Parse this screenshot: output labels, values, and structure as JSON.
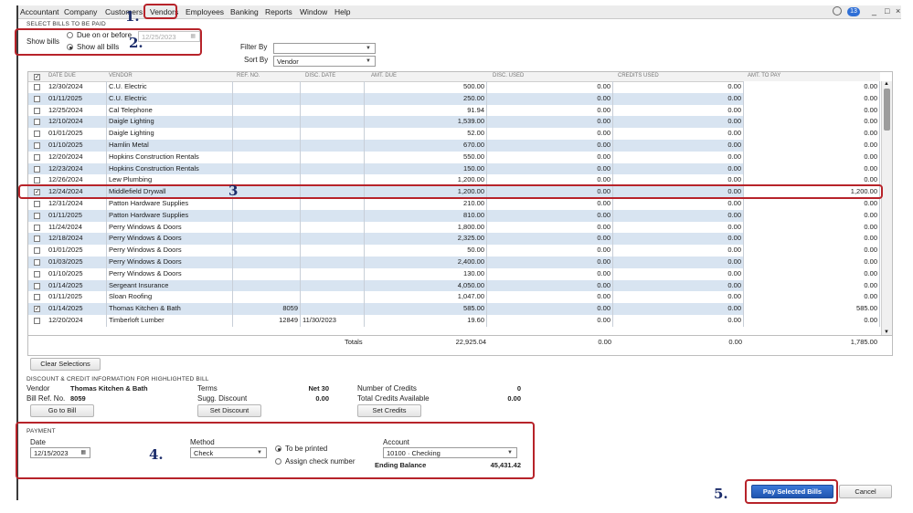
{
  "menu": {
    "items": [
      "Accountant",
      "Company",
      "Customers",
      "Vendors",
      "Employees",
      "Banking",
      "Reports",
      "Window",
      "Help"
    ],
    "notification_count": "13",
    "window_controls": [
      "_",
      "×"
    ]
  },
  "select_bills": {
    "section_title": "SELECT BILLS TO BE PAID",
    "show_bills_label": "Show bills",
    "due_on_or_before_label": "Due on or before",
    "due_date_value": "12/25/2023",
    "show_all_bills_label": "Show all bills",
    "filter_by_label": "Filter By",
    "filter_by_value": "",
    "sort_by_label": "Sort By",
    "sort_by_value": "Vendor"
  },
  "table": {
    "headers": [
      "DATE DUE",
      "VENDOR",
      "REF. NO.",
      "DISC. DATE",
      "AMT. DUE",
      "DISC. USED",
      "CREDITS USED",
      "AMT. TO PAY"
    ],
    "rows": [
      {
        "checked": false,
        "date": "12/30/2024",
        "vendor": "C.U. Electric",
        "ref": "",
        "disc_date": "",
        "amt_due": "500.00",
        "disc_used": "0.00",
        "credits_used": "0.00",
        "amt_to_pay": "0.00"
      },
      {
        "checked": false,
        "date": "01/11/2025",
        "vendor": "C.U. Electric",
        "ref": "",
        "disc_date": "",
        "amt_due": "250.00",
        "disc_used": "0.00",
        "credits_used": "0.00",
        "amt_to_pay": "0.00"
      },
      {
        "checked": false,
        "date": "12/25/2024",
        "vendor": "Cal Telephone",
        "ref": "",
        "disc_date": "",
        "amt_due": "91.94",
        "disc_used": "0.00",
        "credits_used": "0.00",
        "amt_to_pay": "0.00"
      },
      {
        "checked": false,
        "date": "12/10/2024",
        "vendor": "Daigle Lighting",
        "ref": "",
        "disc_date": "",
        "amt_due": "1,539.00",
        "disc_used": "0.00",
        "credits_used": "0.00",
        "amt_to_pay": "0.00"
      },
      {
        "checked": false,
        "date": "01/01/2025",
        "vendor": "Daigle Lighting",
        "ref": "",
        "disc_date": "",
        "amt_due": "52.00",
        "disc_used": "0.00",
        "credits_used": "0.00",
        "amt_to_pay": "0.00"
      },
      {
        "checked": false,
        "date": "01/10/2025",
        "vendor": "Hamlin Metal",
        "ref": "",
        "disc_date": "",
        "amt_due": "670.00",
        "disc_used": "0.00",
        "credits_used": "0.00",
        "amt_to_pay": "0.00"
      },
      {
        "checked": false,
        "date": "12/20/2024",
        "vendor": "Hopkins Construction Rentals",
        "ref": "",
        "disc_date": "",
        "amt_due": "550.00",
        "disc_used": "0.00",
        "credits_used": "0.00",
        "amt_to_pay": "0.00"
      },
      {
        "checked": false,
        "date": "12/23/2024",
        "vendor": "Hopkins Construction Rentals",
        "ref": "",
        "disc_date": "",
        "amt_due": "150.00",
        "disc_used": "0.00",
        "credits_used": "0.00",
        "amt_to_pay": "0.00"
      },
      {
        "checked": false,
        "date": "12/26/2024",
        "vendor": "Lew Plumbing",
        "ref": "",
        "disc_date": "",
        "amt_due": "1,200.00",
        "disc_used": "0.00",
        "credits_used": "0.00",
        "amt_to_pay": "0.00"
      },
      {
        "checked": true,
        "date": "12/24/2024",
        "vendor": "Middlefield Drywall",
        "ref": "",
        "disc_date": "",
        "amt_due": "1,200.00",
        "disc_used": "0.00",
        "credits_used": "0.00",
        "amt_to_pay": "1,200.00"
      },
      {
        "checked": false,
        "date": "12/31/2024",
        "vendor": "Patton Hardware Supplies",
        "ref": "",
        "disc_date": "",
        "amt_due": "210.00",
        "disc_used": "0.00",
        "credits_used": "0.00",
        "amt_to_pay": "0.00"
      },
      {
        "checked": false,
        "date": "01/11/2025",
        "vendor": "Patton Hardware Supplies",
        "ref": "",
        "disc_date": "",
        "amt_due": "810.00",
        "disc_used": "0.00",
        "credits_used": "0.00",
        "amt_to_pay": "0.00"
      },
      {
        "checked": false,
        "date": "11/24/2024",
        "vendor": "Perry Windows & Doors",
        "ref": "",
        "disc_date": "",
        "amt_due": "1,800.00",
        "disc_used": "0.00",
        "credits_used": "0.00",
        "amt_to_pay": "0.00"
      },
      {
        "checked": false,
        "date": "12/18/2024",
        "vendor": "Perry Windows & Doors",
        "ref": "",
        "disc_date": "",
        "amt_due": "2,325.00",
        "disc_used": "0.00",
        "credits_used": "0.00",
        "amt_to_pay": "0.00"
      },
      {
        "checked": false,
        "date": "01/01/2025",
        "vendor": "Perry Windows & Doors",
        "ref": "",
        "disc_date": "",
        "amt_due": "50.00",
        "disc_used": "0.00",
        "credits_used": "0.00",
        "amt_to_pay": "0.00"
      },
      {
        "checked": false,
        "date": "01/03/2025",
        "vendor": "Perry Windows & Doors",
        "ref": "",
        "disc_date": "",
        "amt_due": "2,400.00",
        "disc_used": "0.00",
        "credits_used": "0.00",
        "amt_to_pay": "0.00"
      },
      {
        "checked": false,
        "date": "01/10/2025",
        "vendor": "Perry Windows & Doors",
        "ref": "",
        "disc_date": "",
        "amt_due": "130.00",
        "disc_used": "0.00",
        "credits_used": "0.00",
        "amt_to_pay": "0.00"
      },
      {
        "checked": false,
        "date": "01/14/2025",
        "vendor": "Sergeant Insurance",
        "ref": "",
        "disc_date": "",
        "amt_due": "4,050.00",
        "disc_used": "0.00",
        "credits_used": "0.00",
        "amt_to_pay": "0.00"
      },
      {
        "checked": false,
        "date": "01/11/2025",
        "vendor": "Sloan Roofing",
        "ref": "",
        "disc_date": "",
        "amt_due": "1,047.00",
        "disc_used": "0.00",
        "credits_used": "0.00",
        "amt_to_pay": "0.00"
      },
      {
        "checked": true,
        "date": "01/14/2025",
        "vendor": "Thomas Kitchen & Bath",
        "ref": "8059",
        "disc_date": "",
        "amt_due": "585.00",
        "disc_used": "0.00",
        "credits_used": "0.00",
        "amt_to_pay": "585.00"
      },
      {
        "checked": false,
        "date": "12/20/2024",
        "vendor": "Timberloft Lumber",
        "ref": "12849",
        "disc_date": "11/30/2023",
        "amt_due": "19.60",
        "disc_used": "0.00",
        "credits_used": "0.00",
        "amt_to_pay": "0.00"
      }
    ],
    "totals": {
      "label": "Totals",
      "amt_due": "22,925.04",
      "disc_used": "0.00",
      "credits_used": "0.00",
      "amt_to_pay": "1,785.00"
    },
    "clear_selections_label": "Clear Selections"
  },
  "discount_credit": {
    "section_title": "DISCOUNT & CREDIT INFORMATION FOR HIGHLIGHTED BILL",
    "vendor_label": "Vendor",
    "vendor_value": "Thomas Kitchen & Bath",
    "bill_ref_label": "Bill Ref. No.",
    "bill_ref_value": "8059",
    "terms_label": "Terms",
    "terms_value": "Net 30",
    "sugg_discount_label": "Sugg. Discount",
    "sugg_discount_value": "0.00",
    "num_credits_label": "Number of Credits",
    "num_credits_value": "0",
    "total_credits_label": "Total Credits Available",
    "total_credits_value": "0.00",
    "go_to_bill_label": "Go to Bill",
    "set_discount_label": "Set Discount",
    "set_credits_label": "Set Credits"
  },
  "payment": {
    "section_title": "PAYMENT",
    "date_label": "Date",
    "date_value": "12/15/2023",
    "method_label": "Method",
    "method_value": "Check",
    "to_be_printed_label": "To be printed",
    "assign_check_label": "Assign check number",
    "account_label": "Account",
    "account_value": "10100 · Checking",
    "ending_balance_label": "Ending Balance",
    "ending_balance_value": "45,431.42"
  },
  "footer": {
    "pay_selected_label": "Pay Selected Bills",
    "cancel_label": "Cancel"
  },
  "annotations": [
    "1.",
    "2.",
    "3",
    "4.",
    "5."
  ],
  "colors": {
    "annotation": "#b7232a",
    "row_alt": "#d8e4f1",
    "primary_button": "#2563c4"
  }
}
